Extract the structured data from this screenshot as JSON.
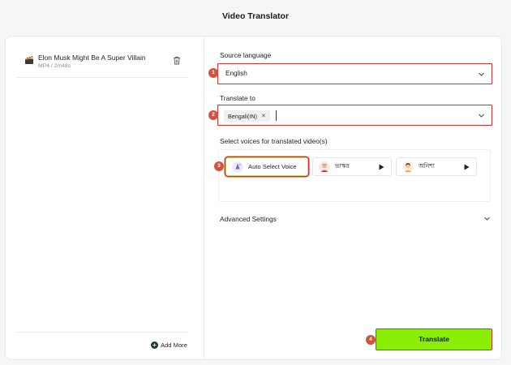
{
  "app": {
    "title": "Video Translator"
  },
  "file": {
    "name": "Elon Musk Might Be A Super Villain",
    "meta": "MP4 / 2m48s"
  },
  "left_footer": {
    "add_more_label": "Add More"
  },
  "source": {
    "label": "Source language",
    "value": "English"
  },
  "target": {
    "label": "Translate to",
    "tags": [
      "Bengali(IN)"
    ]
  },
  "voices": {
    "label": "Select voices for translated video(s)",
    "items": [
      {
        "label": "Auto Select Voice",
        "selected": true
      },
      {
        "label": "ভাস্কর"
      },
      {
        "label": "অনিশা"
      }
    ]
  },
  "advanced": {
    "label": "Advanced Settings"
  },
  "actions": {
    "translate_label": "Translate"
  },
  "steps": [
    "1",
    "2",
    "3",
    "4"
  ],
  "colors": {
    "accent_green": "#8aee06",
    "highlight_red": "#d9302f",
    "step_badge": "#d2533b"
  }
}
